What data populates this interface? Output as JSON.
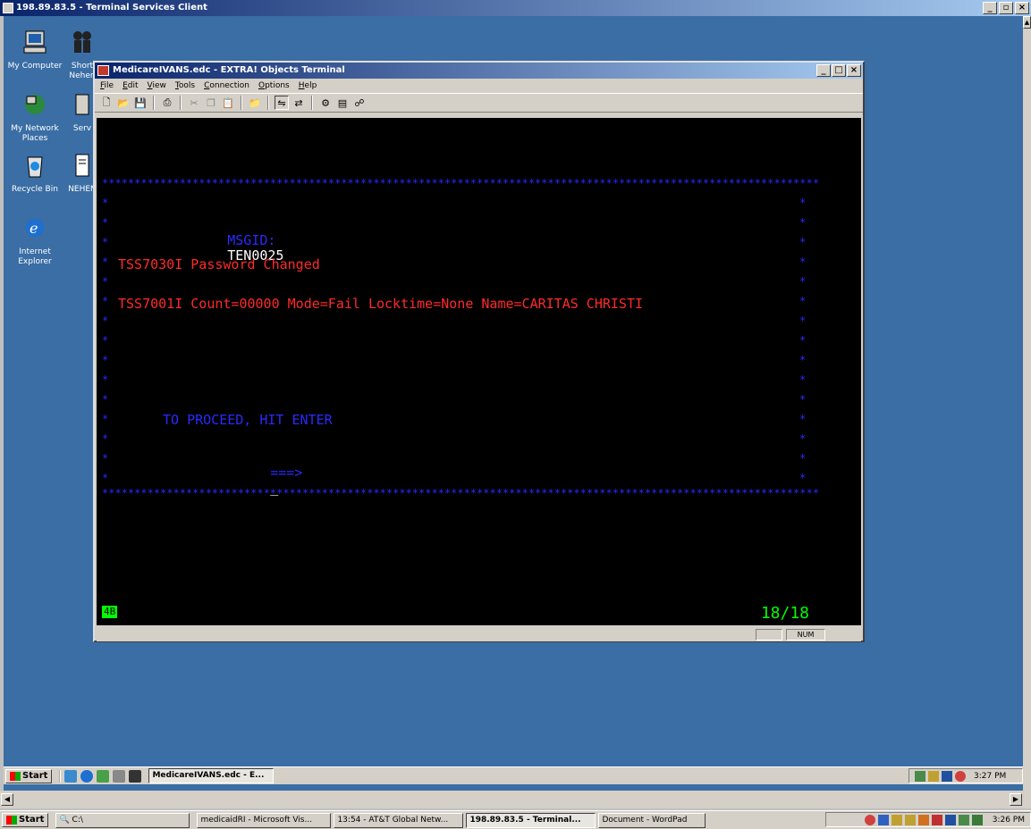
{
  "outer_window": {
    "title": "198.89.83.5 - Terminal Services Client"
  },
  "desktop_icons": [
    {
      "label": "My Computer",
      "icon": "computer-icon"
    },
    {
      "label": "Short Nehen",
      "icon": "shortcut-icon"
    },
    {
      "label": "My Network Places",
      "icon": "network-icon"
    },
    {
      "label": "Serv",
      "icon": "server-icon"
    },
    {
      "label": "Recycle Bin",
      "icon": "recycle-bin-icon"
    },
    {
      "label": "NEHEN",
      "icon": "document-icon"
    },
    {
      "label": "Internet Explorer",
      "icon": "ie-icon"
    }
  ],
  "terminal_window": {
    "title": "MedicareIVANS.edc - EXTRA! Objects Terminal",
    "menu": [
      "File",
      "Edit",
      "View",
      "Tools",
      "Connection",
      "Options",
      "Help"
    ]
  },
  "screen": {
    "msgid_label": "MSGID:",
    "msgid_value": "TEN0025",
    "line1": "TSS7030I Password Changed",
    "line2": "TSS7001I Count=00000 Mode=Fail Locktime=None Name=CARITAS CHRISTI",
    "proceed": "TO PROCEED, HIT ENTER",
    "prompt": "===>",
    "cursor": "_",
    "border_char": "*"
  },
  "oia": {
    "keyboard_indicator": "4B",
    "page_position": "18/18"
  },
  "status_bar": {
    "num_indicator": "NUM"
  },
  "inner_taskbar": {
    "start_label": "Start",
    "tasks": [
      {
        "label": "MedicareIVANS.edc - E...",
        "active": true
      }
    ],
    "clock": "3:27 PM"
  },
  "host_taskbar": {
    "start_label": "Start",
    "address": "C:\\",
    "tasks": [
      {
        "label": "medicaidRI - Microsoft Vis...",
        "active": false
      },
      {
        "label": "13:54 - AT&T Global Netw...",
        "active": false
      },
      {
        "label": "198.89.83.5 - Terminal...",
        "active": true
      },
      {
        "label": "Document - WordPad",
        "active": false
      }
    ],
    "clock": "3:26 PM"
  },
  "colors": {
    "terminal_bg": "#000000",
    "blue_text": "#2a2aff",
    "red_text": "#ff2a2a",
    "green_oia": "#00ff00",
    "desktop": "#3a6ea5"
  }
}
